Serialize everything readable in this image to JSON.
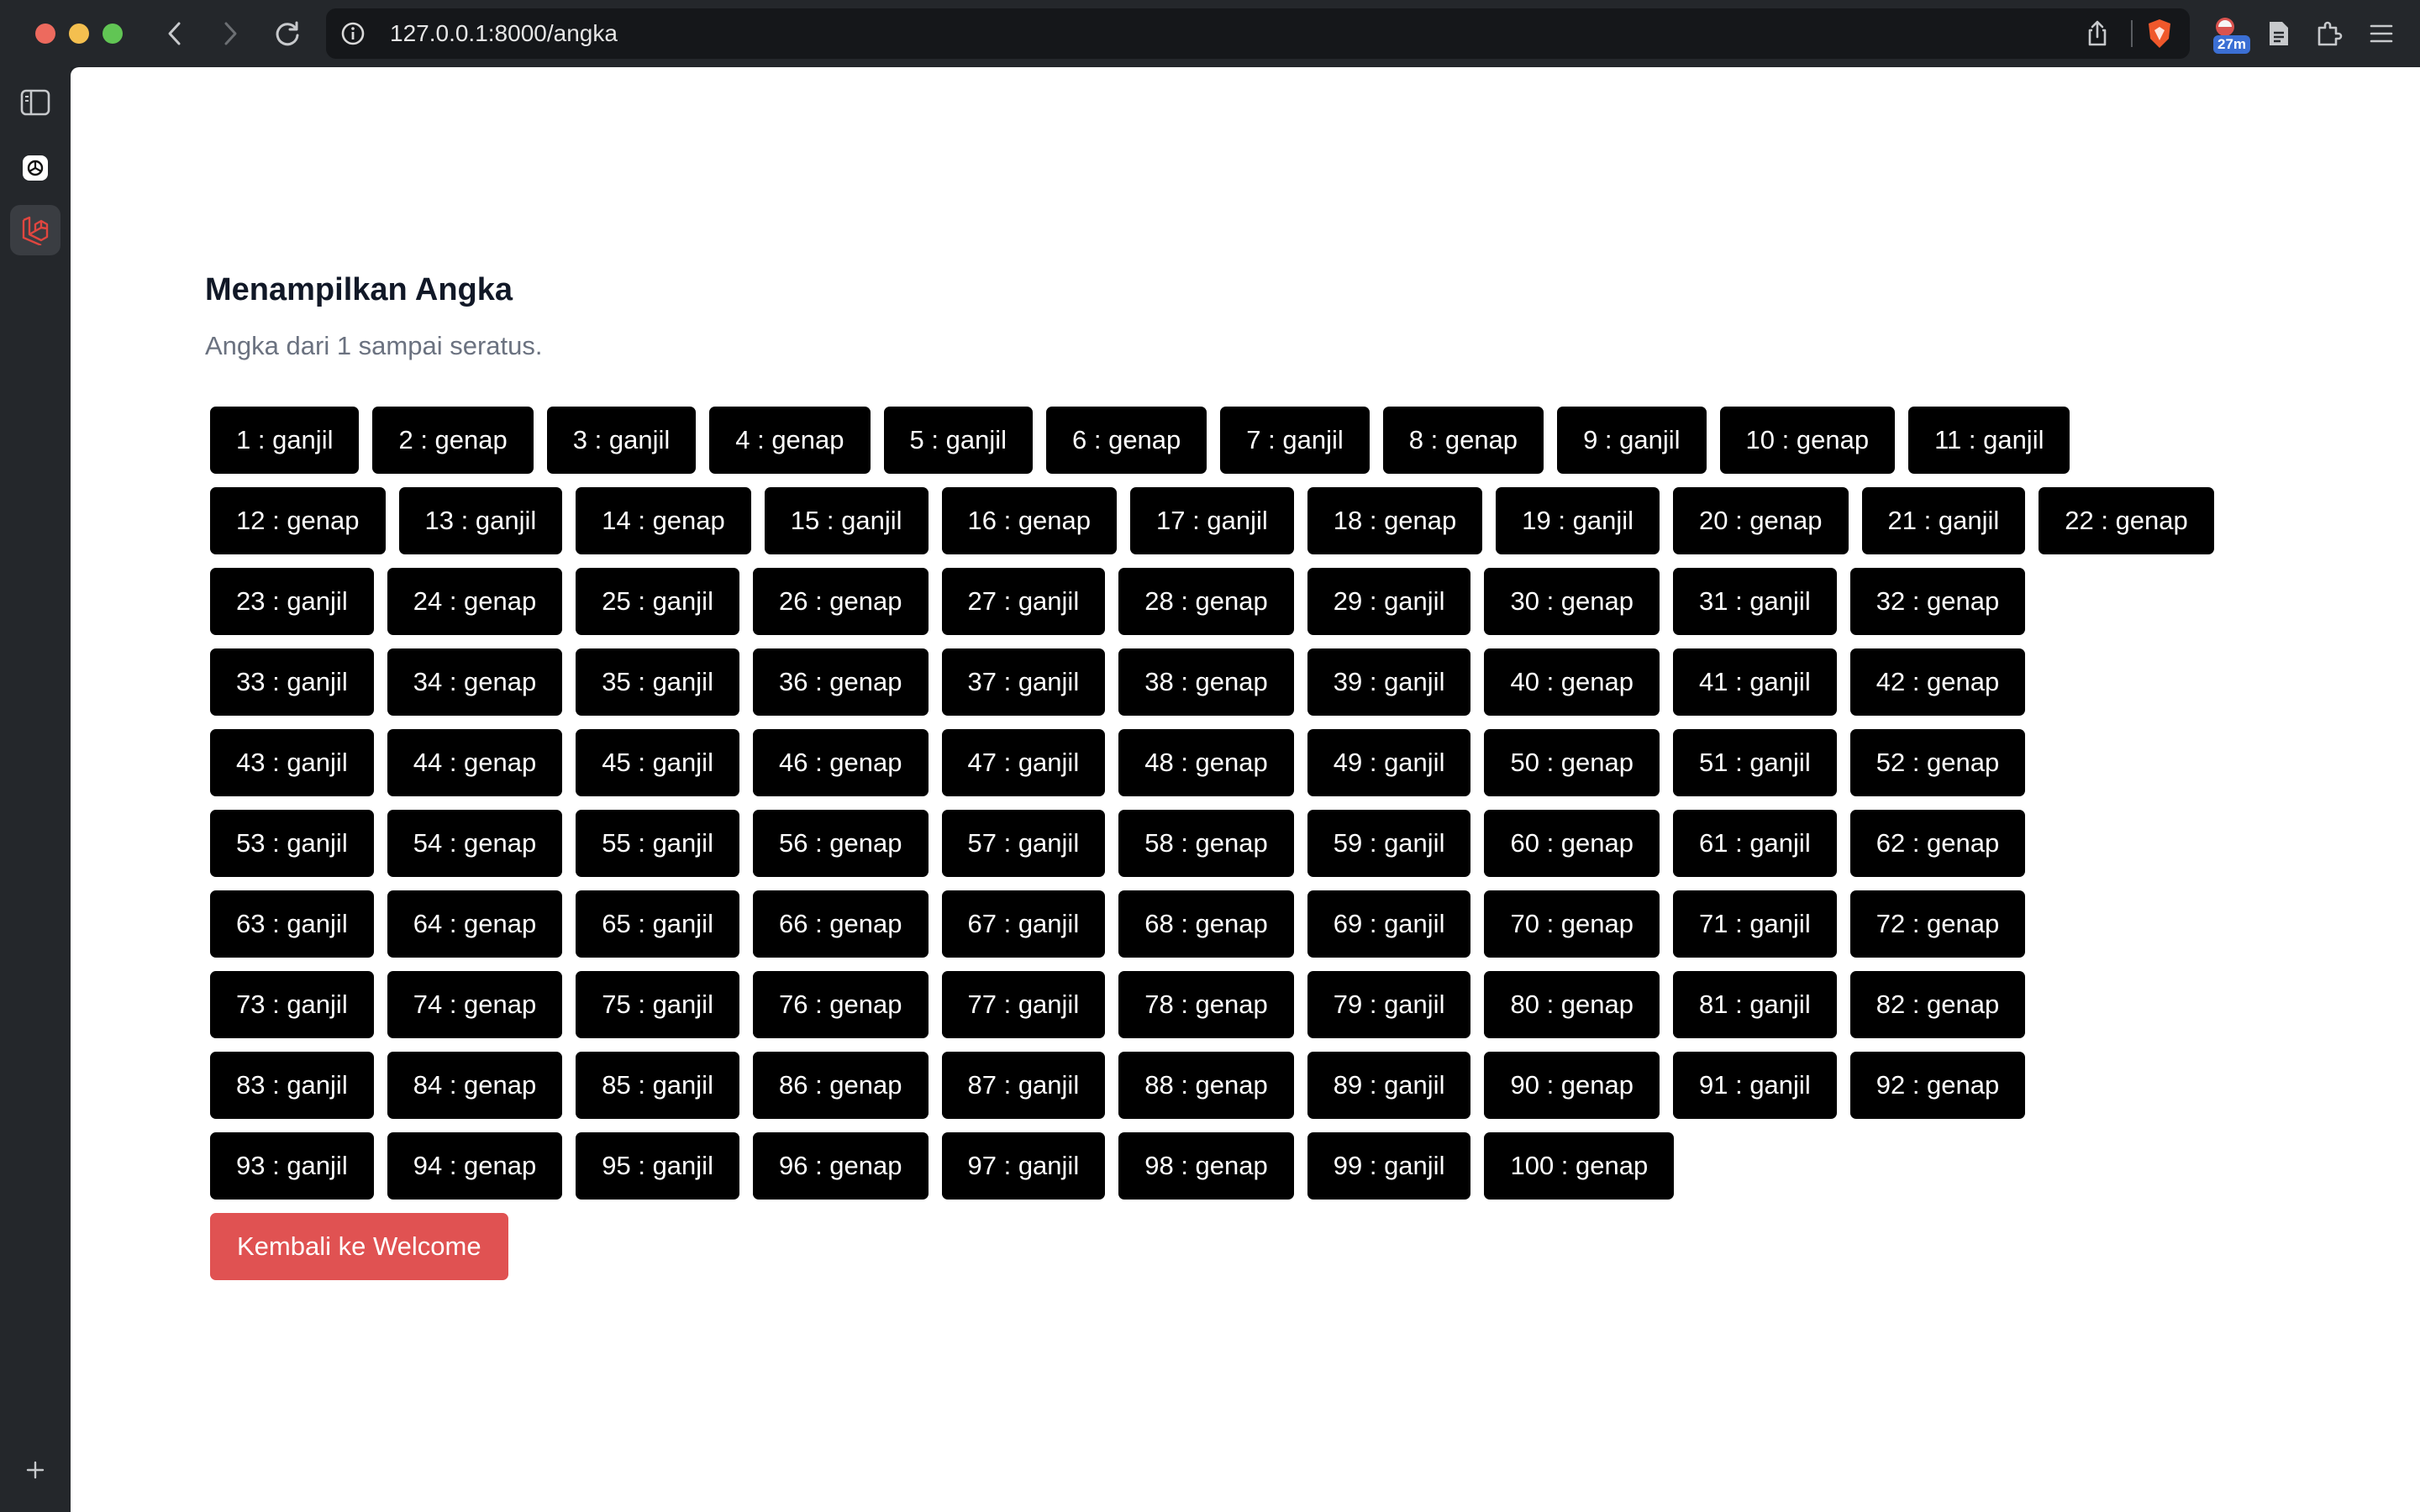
{
  "browser": {
    "url": "127.0.0.1:8000/angka",
    "badge": "27m"
  },
  "page": {
    "title": "Menampilkan Angka",
    "subtitle": "Angka dari 1 sampai seratus.",
    "back_label": "Kembali ke Welcome",
    "back_color": "#e05252",
    "button_color": "#000000"
  },
  "rows": [
    [
      "1 : ganjil",
      "2 : genap",
      "3 : ganjil",
      "4 : genap",
      "5 : ganjil",
      "6 : genap",
      "7 : ganjil",
      "8 : genap",
      "9 : ganjil",
      "10 : genap",
      "11 : ganjil"
    ],
    [
      "12 : genap",
      "13 : ganjil",
      "14 : genap",
      "15 : ganjil",
      "16 : genap",
      "17 : ganjil",
      "18 : genap",
      "19 : ganjil",
      "20 : genap",
      "21 : ganjil",
      "22 : genap"
    ],
    [
      "23 : ganjil",
      "24 : genap",
      "25 : ganjil",
      "26 : genap",
      "27 : ganjil",
      "28 : genap",
      "29 : ganjil",
      "30 : genap",
      "31 : ganjil",
      "32 : genap"
    ],
    [
      "33 : ganjil",
      "34 : genap",
      "35 : ganjil",
      "36 : genap",
      "37 : ganjil",
      "38 : genap",
      "39 : ganjil",
      "40 : genap",
      "41 : ganjil",
      "42 : genap"
    ],
    [
      "43 : ganjil",
      "44 : genap",
      "45 : ganjil",
      "46 : genap",
      "47 : ganjil",
      "48 : genap",
      "49 : ganjil",
      "50 : genap",
      "51 : ganjil",
      "52 : genap"
    ],
    [
      "53 : ganjil",
      "54 : genap",
      "55 : ganjil",
      "56 : genap",
      "57 : ganjil",
      "58 : genap",
      "59 : ganjil",
      "60 : genap",
      "61 : ganjil",
      "62 : genap"
    ],
    [
      "63 : ganjil",
      "64 : genap",
      "65 : ganjil",
      "66 : genap",
      "67 : ganjil",
      "68 : genap",
      "69 : ganjil",
      "70 : genap",
      "71 : ganjil",
      "72 : genap"
    ],
    [
      "73 : ganjil",
      "74 : genap",
      "75 : ganjil",
      "76 : genap",
      "77 : ganjil",
      "78 : genap",
      "79 : ganjil",
      "80 : genap",
      "81 : ganjil",
      "82 : genap"
    ],
    [
      "83 : ganjil",
      "84 : genap",
      "85 : ganjil",
      "86 : genap",
      "87 : ganjil",
      "88 : genap",
      "89 : ganjil",
      "90 : genap",
      "91 : ganjil",
      "92 : genap"
    ],
    [
      "93 : ganjil",
      "94 : genap",
      "95 : ganjil",
      "96 : genap",
      "97 : ganjil",
      "98 : genap",
      "99 : ganjil",
      "100 : genap"
    ]
  ],
  "icons": {
    "nav": [
      "back-icon",
      "forward-icon",
      "reload-icon"
    ],
    "sidebar": [
      "sidebar-panel-icon",
      "openai-icon",
      "laravel-icon",
      "add-icon"
    ],
    "toolbar": [
      "share-icon",
      "brave-shield-icon",
      "extension-badge-icon",
      "reader-icon",
      "extensions-puzzle-icon",
      "menu-icon"
    ]
  }
}
